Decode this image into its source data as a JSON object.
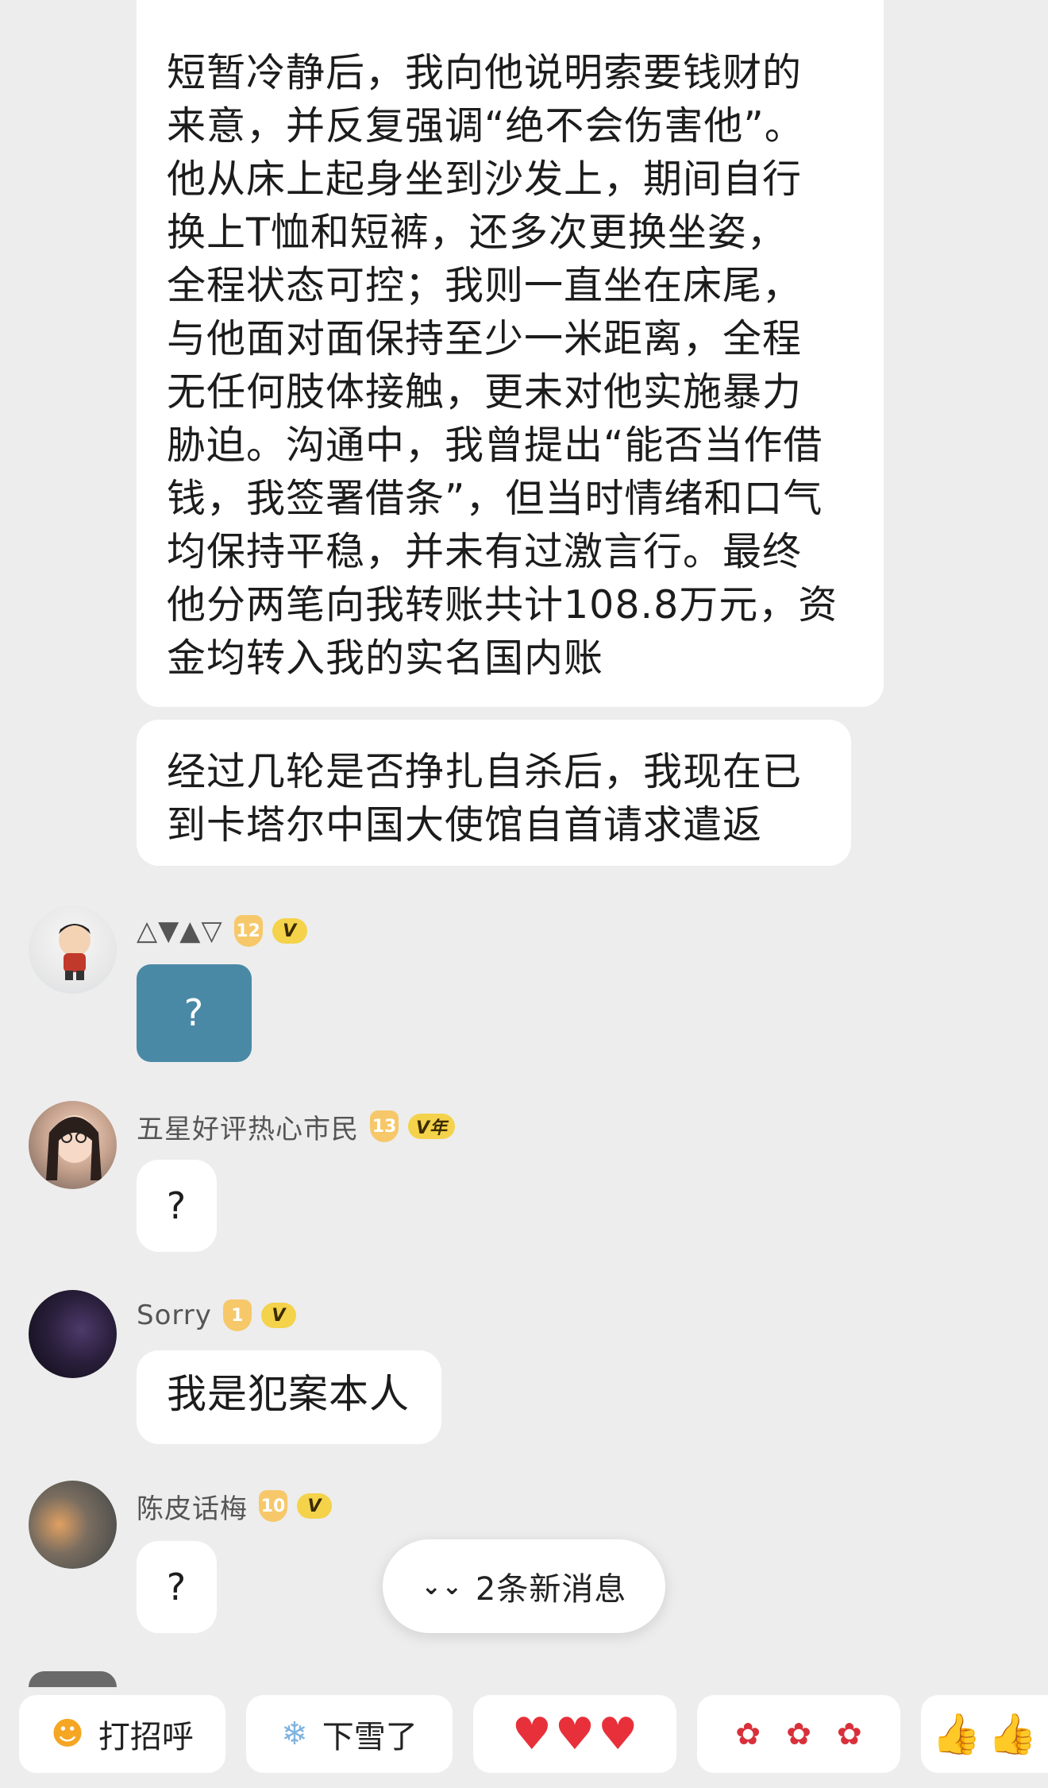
{
  "messages": {
    "long_text": "短暂冷静后，我向他说明索要钱财的\n来意，并反复强调“绝不会伤害他”。\n他从床上起身坐到沙发上，期间自行\n换上T恤和短裤，还多次更换坐姿，\n全程状态可控；我则一直坐在床尾，\n与他面对面保持至少一米距离，全程\n无任何肢体接触，更未对他实施暴力\n胁迫。沟通中，我曾提出“能否当作借\n钱，我签署借条”，但当时情绪和口气\n均保持平稳，并未有过激言行。最终\n他分两笔向我转账共计108.8万元，资\n金均转入我的实名国内账",
    "second_text": "经过几轮是否挣扎自杀后，我现在已\n到卡塔尔中国大使馆自首请求遣返"
  },
  "users": [
    {
      "name": "△▼▲▽",
      "level": "12",
      "badge": "V",
      "message": "?"
    },
    {
      "name": "五星好评热心市民",
      "level": "13",
      "badge": "V年",
      "message": "?"
    },
    {
      "name": "Sorry",
      "level": "1",
      "badge": "V",
      "message": "我是犯案本人"
    },
    {
      "name": "陈皮话梅",
      "level": "10",
      "badge": "V",
      "message": "?"
    }
  ],
  "new_messages": {
    "icon": "chevron-double-down-icon",
    "label": "2条新消息"
  },
  "quick_replies": [
    {
      "icon": "smile-face-icon",
      "label": "打招呼"
    },
    {
      "icon": "snowflake-icon",
      "label": "下雪了"
    },
    {
      "icon": "hearts-icon",
      "label": ""
    },
    {
      "icon": "roses-icon",
      "label": ""
    },
    {
      "icon": "thumbs-up-icon",
      "label": ""
    }
  ]
}
